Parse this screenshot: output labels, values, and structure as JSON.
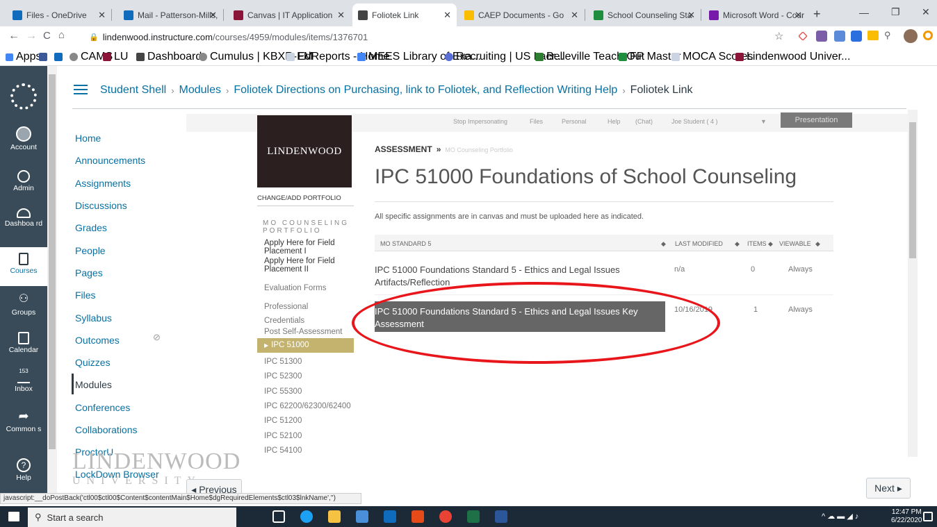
{
  "browser": {
    "tabs": [
      {
        "title": "Files - OneDrive",
        "color": "#0f6cbd"
      },
      {
        "title": "Mail - Patterson-Mills, ",
        "color": "#0f6cbd"
      },
      {
        "title": "Canvas | IT Application",
        "color": "#8a1538"
      },
      {
        "title": "Foliotek Link",
        "color": "#444444"
      },
      {
        "title": "CAEP Documents - Go",
        "color": "#fbbc04"
      },
      {
        "title": "School Counseling Sta",
        "color": "#1e8e3e"
      },
      {
        "title": "Microsoft Word - Cour",
        "color": "#7719aa"
      }
    ],
    "new_tab": "+",
    "url_host": "lindenwood.instructure.com",
    "url_path": "/courses/4959/modules/items/1376701",
    "bookmarks": [
      "Apps",
      "CAMS",
      "LU",
      "Dashboard",
      "Cumulus | KBXR-FM",
      "EdReports - Home",
      "MEES Library of Exa...",
      "Recruiting | US Lacr...",
      "Belleville Teach-Out",
      "FP Master",
      "MOCA Scores",
      "Lindenwood Univer..."
    ]
  },
  "global_nav": [
    {
      "label": "Account",
      "icon": "account-icon"
    },
    {
      "label": "Admin",
      "icon": "admin-icon"
    },
    {
      "label": "Dashboa rd",
      "icon": "dashboard-icon"
    },
    {
      "label": "Courses",
      "icon": "courses-icon"
    },
    {
      "label": "Groups",
      "icon": "groups-icon"
    },
    {
      "label": "Calendar",
      "icon": "calendar-icon"
    },
    {
      "label": "Inbox",
      "icon": "inbox-icon",
      "badge": "153"
    },
    {
      "label": "Common s",
      "icon": "commons-icon"
    },
    {
      "label": "Help",
      "icon": "help-icon"
    }
  ],
  "breadcrumb": [
    "Student Shell",
    "Modules",
    "Foliotek Directions on Purchasing, link to Foliotek, and Reflection Writing Help",
    "Foliotek Link"
  ],
  "course_nav": [
    "Home",
    "Announcements",
    "Assignments",
    "Discussions",
    "Grades",
    "People",
    "Pages",
    "Files",
    "Syllabus",
    "Outcomes",
    "Quizzes",
    "Modules",
    "Conferences",
    "Collaborations",
    "ProctorU",
    "LockDown Browser"
  ],
  "foliotek": {
    "top_links": [
      "Stop Impersonating",
      "Files",
      "Personal",
      "Help",
      "(Chat)",
      "Joe Student ( 4 )"
    ],
    "presentation": "Presentation",
    "logo": "LINDENWOOD",
    "change_portfolio": "CHANGE/ADD PORTFOLIO",
    "portfolio_heading": "MO COUNSELING PORTFOLIO",
    "portfolio_items": [
      "Apply Here for Field Placement I",
      "Apply Here for Field Placement II",
      "Evaluation Forms",
      "Professional Credentials",
      "Post Self-Assessment",
      "IPC 51000",
      "IPC 51300",
      "IPC 52300",
      "IPC 55300",
      "IPC 62200/62300/62400",
      "IPC 51200",
      "IPC 52100",
      "IPC 54100"
    ],
    "assessment_label": "ASSESSMENT",
    "assessment_crumb": "MO Counseling Portfolio",
    "page_title": "IPC 51000 Foundations of School Counseling",
    "instructions": "All specific assignments are in canvas and must be uploaded here as indicated.",
    "table_headers": [
      "MO STANDARD 5",
      "LAST MODIFIED",
      "ITEMS",
      "VIEWABLE"
    ],
    "rows": [
      {
        "title": "IPC 51000 Foundations Standard 5 - Ethics and Legal Issues Artifacts/Reflection",
        "modified": "n/a",
        "items": "0",
        "viewable": "Always"
      },
      {
        "title": "IPC 51000 Foundations Standard 5 - Ethics and Legal Issues Key Assessment",
        "modified": "10/16/2019",
        "items": "1",
        "viewable": "Always"
      }
    ]
  },
  "footer": {
    "previous": "◂ Previous",
    "next": "Next ▸",
    "watermark": "LINDENWOOD",
    "watermark_sub": "UNIVERSITY"
  },
  "status_bar": "javascript:__doPostBack('ctl00$ctl00$Content$contentMain$Home$dgRequiredElements$ctl03$lnkName','')",
  "taskbar": {
    "search_placeholder": "Start a search",
    "time": "12:47 PM",
    "date": "6/22/2020"
  },
  "colors": {
    "canvas_nav": "#394b58",
    "link": "#0770a3",
    "highlight_oval": "#e8151b",
    "selected_portfolio": "#c3b36f"
  }
}
